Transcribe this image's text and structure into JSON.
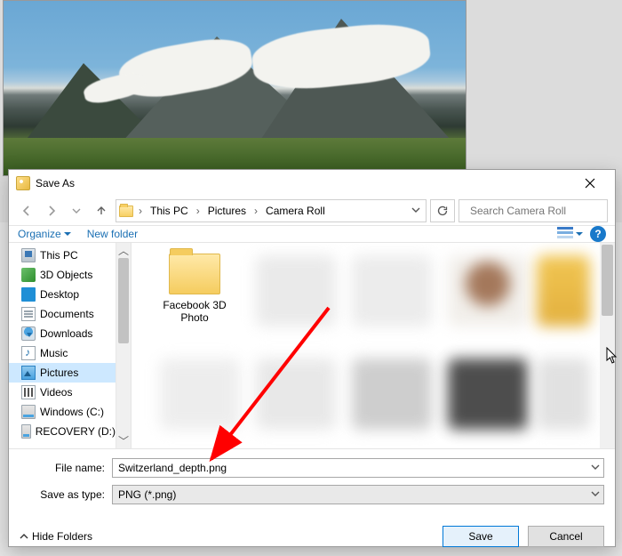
{
  "dialog": {
    "title": "Save As",
    "close_tooltip": "Close"
  },
  "breadcrumb": {
    "segments": [
      "This PC",
      "Pictures",
      "Camera Roll"
    ]
  },
  "search": {
    "placeholder": "Search Camera Roll"
  },
  "toolbar": {
    "organize": "Organize",
    "new_folder": "New folder",
    "help": "?"
  },
  "sidebar": {
    "items": [
      {
        "label": "This PC"
      },
      {
        "label": "3D Objects"
      },
      {
        "label": "Desktop"
      },
      {
        "label": "Documents"
      },
      {
        "label": "Downloads"
      },
      {
        "label": "Music"
      },
      {
        "label": "Pictures",
        "selected": true
      },
      {
        "label": "Videos"
      },
      {
        "label": "Windows (C:)"
      },
      {
        "label": "RECOVERY (D:)"
      }
    ]
  },
  "filepane": {
    "folder_label": "Facebook 3D Photo"
  },
  "fields": {
    "file_name_label": "File name:",
    "file_name_value": "Switzerland_depth.png",
    "save_type_label": "Save as type:",
    "save_type_value": "PNG (*.png)"
  },
  "footer": {
    "hide_folders": "Hide Folders",
    "save": "Save",
    "cancel": "Cancel"
  }
}
